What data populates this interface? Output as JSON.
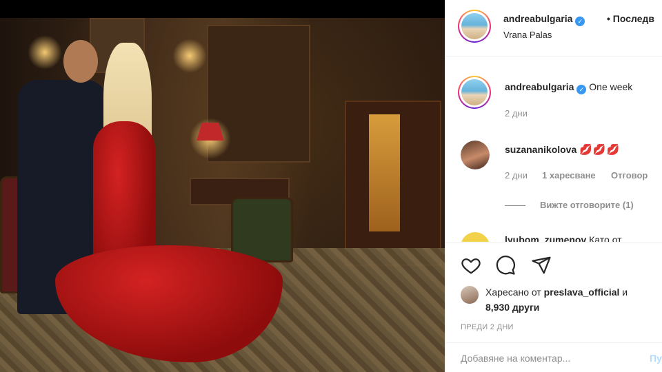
{
  "post": {
    "author": "andreabulgaria",
    "follow_label": "• Последв",
    "location": "Vrana Palas"
  },
  "caption": {
    "author": "andreabulgaria",
    "text": "One week",
    "time": "2 дни"
  },
  "comments": [
    {
      "author": "suzananikolova",
      "text": "💋💋💋",
      "time": "2 дни",
      "likes": "1 харесване",
      "reply_label": "Отговор",
      "view_replies": "Вижте отговорите (1)"
    },
    {
      "author": "lyubom_zumenov",
      "text": "Като от"
    }
  ],
  "likes": {
    "prefix": "Харесано от",
    "liker": "preslava_official",
    "connector": "и",
    "others": "8,930 други"
  },
  "time_ago": "ПРЕДИ 2 ДНИ",
  "add_comment": {
    "placeholder": "Добавяне на коментар...",
    "post_label": "Пу"
  },
  "colors": {
    "verified": "#3897f0",
    "muted": "#8e8e8e",
    "post_button": "#b3dbff"
  }
}
